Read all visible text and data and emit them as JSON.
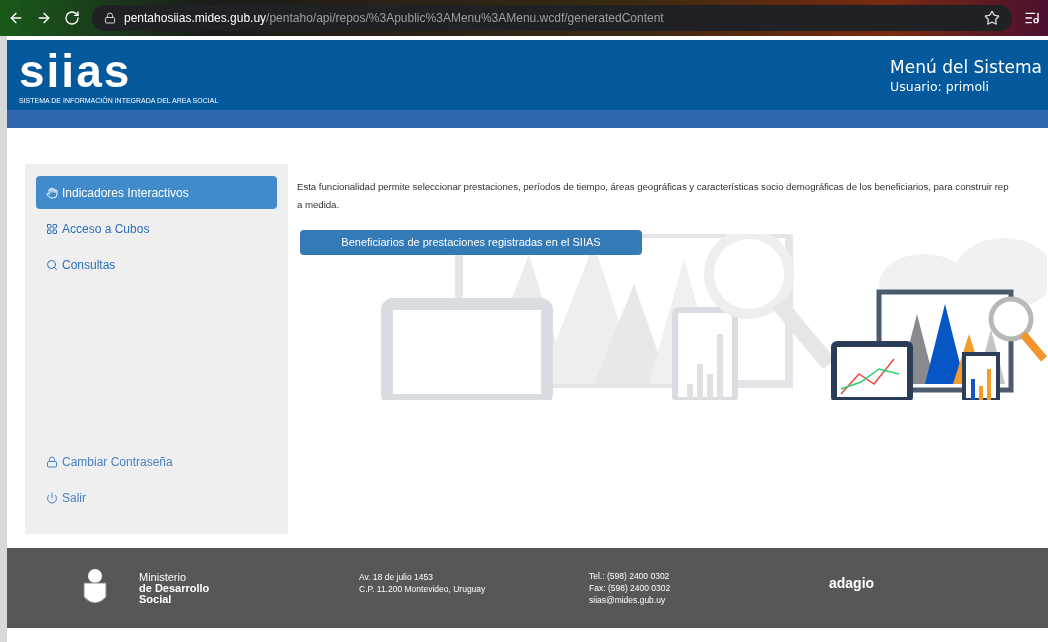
{
  "browser": {
    "url_host": "pentahosiias.mides.gub.uy",
    "url_path": "/pentaho/api/repos/%3Apublic%3AMenu%3AMenu.wcdf/generatedContent"
  },
  "header": {
    "logo": "siias",
    "logo_subtitle": "SISTEMA DE INFORMACIÓN INTEGRADA DEL AREA SOCIAL",
    "title": "Menú del Sistema",
    "user": "Usuario: primoli"
  },
  "sidebar": {
    "items": [
      {
        "label": "Indicadores Interactivos",
        "selected": true
      },
      {
        "label": "Acceso a Cubos",
        "selected": false
      },
      {
        "label": "Consultas",
        "selected": false
      }
    ],
    "bottom_items": [
      {
        "label": "Cambiar Contraseña"
      },
      {
        "label": "Salir"
      }
    ]
  },
  "content": {
    "description_lines": [
      "Esta funcionalidad permite seleccionar prestaciones, períodos de tiempo, áreas geográficas y características socio demográficas de los beneficiarios, para construir rep",
      "a medida."
    ],
    "button": "Beneficiarios de prestaciones registradas en el SIIAS"
  },
  "footer": {
    "ministry": [
      "Ministerio",
      "de Desarrollo",
      "Social"
    ],
    "address": [
      "Av. 18 de julio 1453",
      "C.P. 11.200 Montevideo, Uruguay"
    ],
    "contact": [
      "Tel.: (598) 2400 0302",
      "Fax: (598) 2400 0302",
      "siias@mides.gub.uy"
    ],
    "partner_logo": "adagio"
  }
}
